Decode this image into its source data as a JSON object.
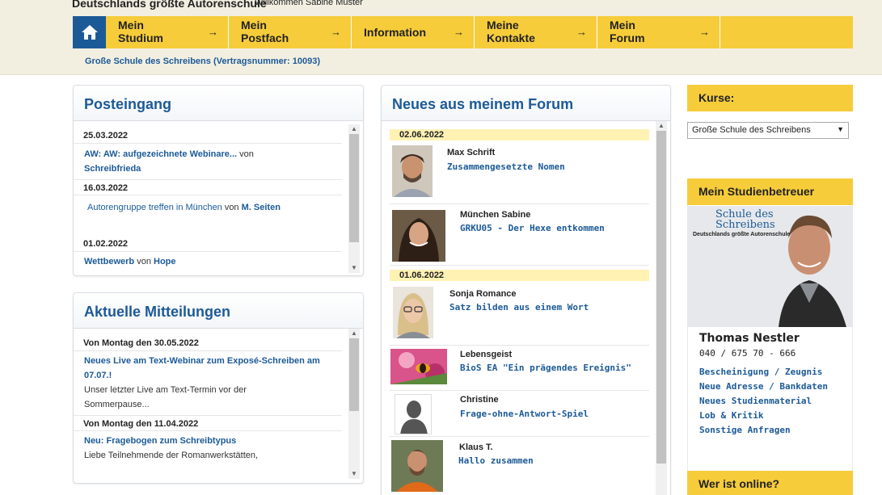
{
  "header": {
    "brand": "Deutschlands größte Autorenschule",
    "welcome_prefix": "Willkommen",
    "user_name": "Sabine Muster",
    "contract": "Große Schule des Schreibens (Vertragsnummer: 10093)"
  },
  "nav": {
    "items": [
      {
        "line1": "Mein",
        "line2": "Studium"
      },
      {
        "line1": "Mein",
        "line2": "Postfach"
      },
      {
        "line1": "Information",
        "line2": ""
      },
      {
        "line1": "Meine",
        "line2": "Kontakte"
      },
      {
        "line1": "Mein",
        "line2": "Forum"
      }
    ],
    "arrow": "→"
  },
  "inbox": {
    "title": "Posteingang",
    "by_word": "von",
    "messages": [
      {
        "date": "25.03.2022",
        "subject": "AW: AW: aufgezeichnete Webinare...",
        "sender": "Schreibfrieda"
      },
      {
        "date": "16.03.2022",
        "subject": "Autorengruppe treffen in München",
        "sender": "M. Seiten"
      },
      {
        "date": "01.02.2022",
        "subject": "Wettbewerb",
        "sender": "Hope"
      }
    ]
  },
  "news": {
    "title": "Aktuelle Mitteilungen",
    "items": [
      {
        "date": "Von Montag den 30.05.2022",
        "title": "Neues Live am Text-Webinar zum Exposé-Schreiben am 07.07.!",
        "teaser": "Unser letzter Live am Text-Termin vor der Sommerpause..."
      },
      {
        "date": "Von Montag den 11.04.2022",
        "title": "Neu: Fragebogen zum Schreibtypus",
        "teaser": "Liebe Teilnehmende der Romanwerkstätten,"
      }
    ]
  },
  "forum": {
    "title": "Neues aus meinem Forum",
    "groups": [
      {
        "date": "02.06.2022",
        "posts": [
          {
            "author": "Max Schrift",
            "topic": "Zusammengesetzte Nomen"
          },
          {
            "author": "München Sabine",
            "topic": "GRKU05 - Der Hexe entkommen"
          }
        ]
      },
      {
        "date": "01.06.2022",
        "posts": [
          {
            "author": "Sonja Romance",
            "topic": "Satz bilden aus einem Wort"
          },
          {
            "author": "Lebensgeist",
            "topic": "BioS EA \"Ein prägendes Ereignis\""
          },
          {
            "author": "Christine",
            "topic": "Frage-ohne-Antwort-Spiel"
          },
          {
            "author": "Klaus T.",
            "topic": "Hallo zusammen"
          }
        ]
      }
    ]
  },
  "courses": {
    "title": "Kurse:",
    "selected": "Große Schule des Schreibens"
  },
  "advisor": {
    "title": "Mein Studienbetreuer",
    "logo_line1": "Schule des",
    "logo_line2": "Schreibens",
    "logo_tagline": "Deutschlands größte Autorenschule",
    "name": "Thomas Nestler",
    "phone": "040 / 675 70 - 666",
    "links": [
      "Bescheinigung / Zeugnis",
      "Neue Adresse / Bankdaten",
      "Neues Studienmaterial",
      "Lob & Kritik",
      "Sonstige Anfragen"
    ]
  },
  "online": {
    "title": "Wer ist online?"
  },
  "colors": {
    "brand_blue": "#1c5a97",
    "accent_yellow": "#f6cc3a",
    "date_highlight": "#fff2b3"
  }
}
